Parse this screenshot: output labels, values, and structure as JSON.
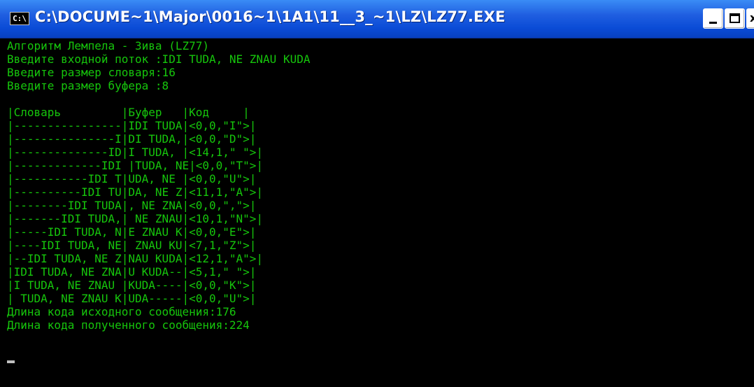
{
  "window": {
    "title": "C:\\DOCUME~1\\Major\\0016~1\\1A1\\11__3_~1\\LZ\\LZ77.EXE",
    "icon_text": "C:\\",
    "buttons": [
      "minimize-icon",
      "maximize-icon",
      "close-icon"
    ]
  },
  "console": {
    "text_color": "#16c60c",
    "background": "#000000",
    "lines": [
      "Алгоритм Лемпела - Зива (LZ77)",
      "Введите входной поток :IDI TUDA, NE ZNAU KUDA",
      "Введите размер словаря:16",
      "Введите размер буфера :8",
      "",
      "|Словарь         |Буфер   |Код     |",
      "|----------------|IDI TUDA|<0,0,\"I\">|",
      "|---------------I|DI TUDA,|<0,0,\"D\">|",
      "|--------------ID|I TUDA, |<14,1,\" \">|",
      "|-------------IDI |TUDA, NE|<0,0,\"T\">|",
      "|-----------IDI T|UDA, NE |<0,0,\"U\">|",
      "|----------IDI TU|DA, NE Z|<11,1,\"A\">|",
      "|--------IDI TUDA|, NE ZNA|<0,0,\",\">|",
      "|-------IDI TUDA,| NE ZNAU|<10,1,\"N\">|",
      "|-----IDI TUDA, N|E ZNAU K|<0,0,\"E\">|",
      "|----IDI TUDA, NE| ZNAU KU|<7,1,\"Z\">|",
      "|--IDI TUDA, NE Z|NAU KUDA|<12,1,\"A\">|",
      "|IDI TUDA, NE ZNA|U KUDA--|<5,1,\" \">|",
      "|I TUDA, NE ZNAU |KUDA----|<0,0,\"K\">|",
      "| TUDA, NE ZNAU K|UDA-----|<0,0,\"U\">|",
      "Длина кода исходного сообщения:176",
      "Длина кода полученного сообщения:224"
    ]
  }
}
